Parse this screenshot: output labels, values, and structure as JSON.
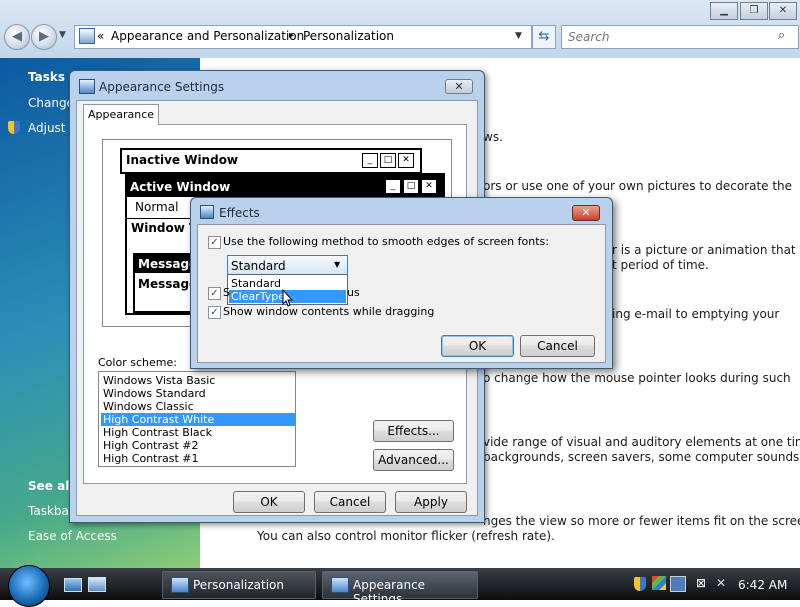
{
  "explorer": {
    "breadcrumb_sep": "«",
    "breadcrumb_1": "Appearance and Personalization",
    "breadcrumb_arrow": "▸",
    "breadcrumb_2": "Personalization",
    "search_placeholder": "Search",
    "left_pane": {
      "tasks_heading": "Tasks",
      "task_1": "Change",
      "task_2": "Adjust f",
      "see_also_heading": "See als",
      "see_also_1": "Taskbar",
      "see_also_2": "Ease of Access"
    },
    "main_lines": [
      "ws.",
      "ors or use one of your own pictures to decorate the",
      "r is a picture or animation that",
      "t period of time.",
      "ing e-mail to emptying your",
      "o change how the mouse pointer looks during such",
      "vide range of visual and auditory elements at one time",
      "backgrounds, screen savers, some computer sounds, and",
      "nges the view so more or fewer items fit on the screen.",
      "You can also control monitor flicker (refresh rate)."
    ]
  },
  "appearance_window": {
    "title": "Appearance Settings",
    "tab": "Appearance",
    "preview": {
      "inactive": "Inactive Window",
      "active": "Active Window",
      "normal": "Normal",
      "window_text": "Window Te",
      "message_box": "Message",
      "message_text": "Message"
    },
    "color_scheme_label": "Color scheme:",
    "schemes": [
      "Windows Vista Basic",
      "Windows Standard",
      "Windows Classic",
      "High Contrast White",
      "High Contrast Black",
      "High Contrast #2",
      "High Contrast #1"
    ],
    "selected_scheme": "High Contrast White",
    "effects_button": "Effects...",
    "advanced_button": "Advanced...",
    "ok": "OK",
    "cancel": "Cancel",
    "apply": "Apply"
  },
  "effects_dialog": {
    "title": "Effects",
    "smooth_label": "Use the following method to smooth edges of screen fonts:",
    "smooth_checked": true,
    "combo_value": "Standard",
    "options": [
      "Standard",
      "ClearType"
    ],
    "highlighted_option": "ClearType",
    "shadow_label_partial": "us",
    "shadow_checked": true,
    "drag_label": "Show window contents while dragging",
    "drag_checked": true,
    "ok": "OK",
    "cancel": "Cancel"
  },
  "taskbar": {
    "task_1": "Personalization",
    "task_2": "Appearance Settings",
    "clock": "6:42 AM"
  },
  "colors": {
    "selection": "#3399ff",
    "window_frame": "#b9d1ea",
    "taskbar": "#1b1d21"
  }
}
